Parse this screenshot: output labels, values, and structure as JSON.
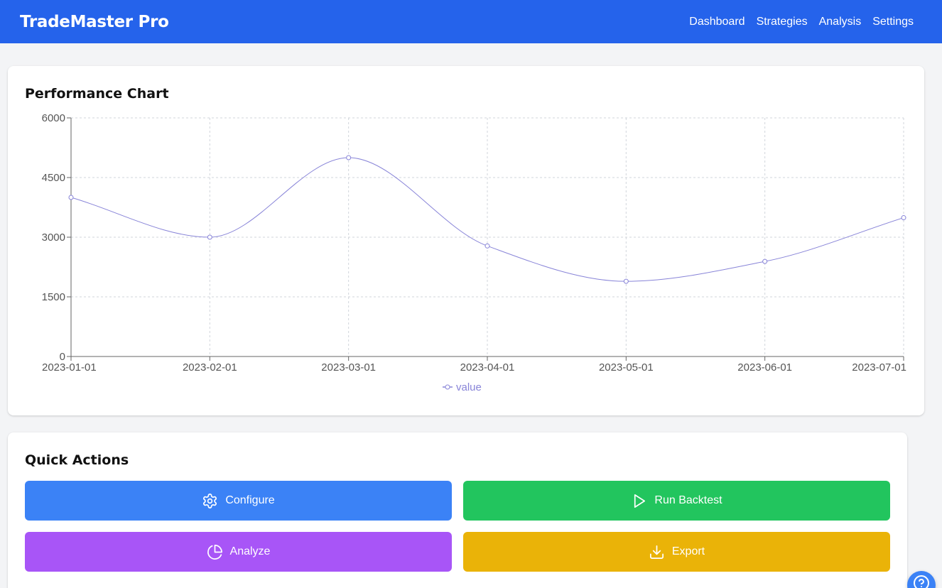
{
  "app": {
    "title": "TradeMaster Pro"
  },
  "nav": [
    {
      "label": "Dashboard",
      "name": "nav-dashboard"
    },
    {
      "label": "Strategies",
      "name": "nav-strategies"
    },
    {
      "label": "Analysis",
      "name": "nav-analysis"
    },
    {
      "label": "Settings",
      "name": "nav-settings"
    }
  ],
  "chart_card": {
    "title": "Performance Chart"
  },
  "chart_data": {
    "type": "line",
    "x": [
      "2023-01-01",
      "2023-02-01",
      "2023-03-01",
      "2023-04-01",
      "2023-05-01",
      "2023-06-01",
      "2023-07-01"
    ],
    "series": [
      {
        "name": "value",
        "values": [
          4000,
          3000,
          5000,
          2780,
          1890,
          2390,
          3490
        ],
        "color": "#8884d8"
      }
    ],
    "ylim": [
      0,
      6000
    ],
    "yticks": [
      0,
      1500,
      3000,
      4500,
      6000
    ],
    "grid": true,
    "legend": "bottom"
  },
  "actions": {
    "title": "Quick Actions",
    "configure_label": "Configure",
    "backtest_label": "Run Backtest",
    "analyze_label": "Analyze",
    "export_label": "Export"
  },
  "colors": {
    "header": "#2563eb",
    "configure": "#3b82f6",
    "backtest": "#22c55e",
    "analyze": "#a855f7",
    "export": "#eab308"
  }
}
